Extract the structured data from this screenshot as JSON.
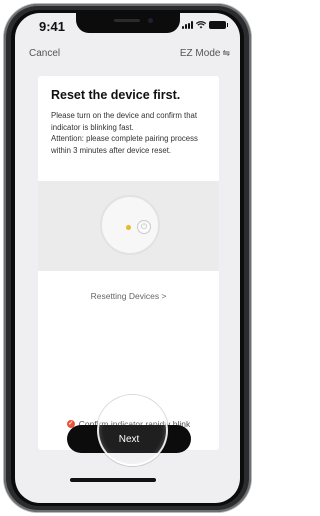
{
  "status_bar": {
    "time": "9:41"
  },
  "nav": {
    "cancel_label": "Cancel",
    "mode_label": "EZ Mode",
    "mode_icon": "swap-arrows-icon"
  },
  "card": {
    "title": "Reset the device first.",
    "instructions": "Please turn on the device and confirm that indicator is blinking fast.",
    "attention": "Attention: please complete pairing process within 3 minutes after device reset.",
    "resetting_link": "Resetting Devices >",
    "confirm_label": "Confirm indicator rapidly blink"
  },
  "next_button": {
    "label": "Next"
  },
  "colors": {
    "accent": "#e8533a",
    "button": "#0c0c0d",
    "led": "#e8b928"
  }
}
